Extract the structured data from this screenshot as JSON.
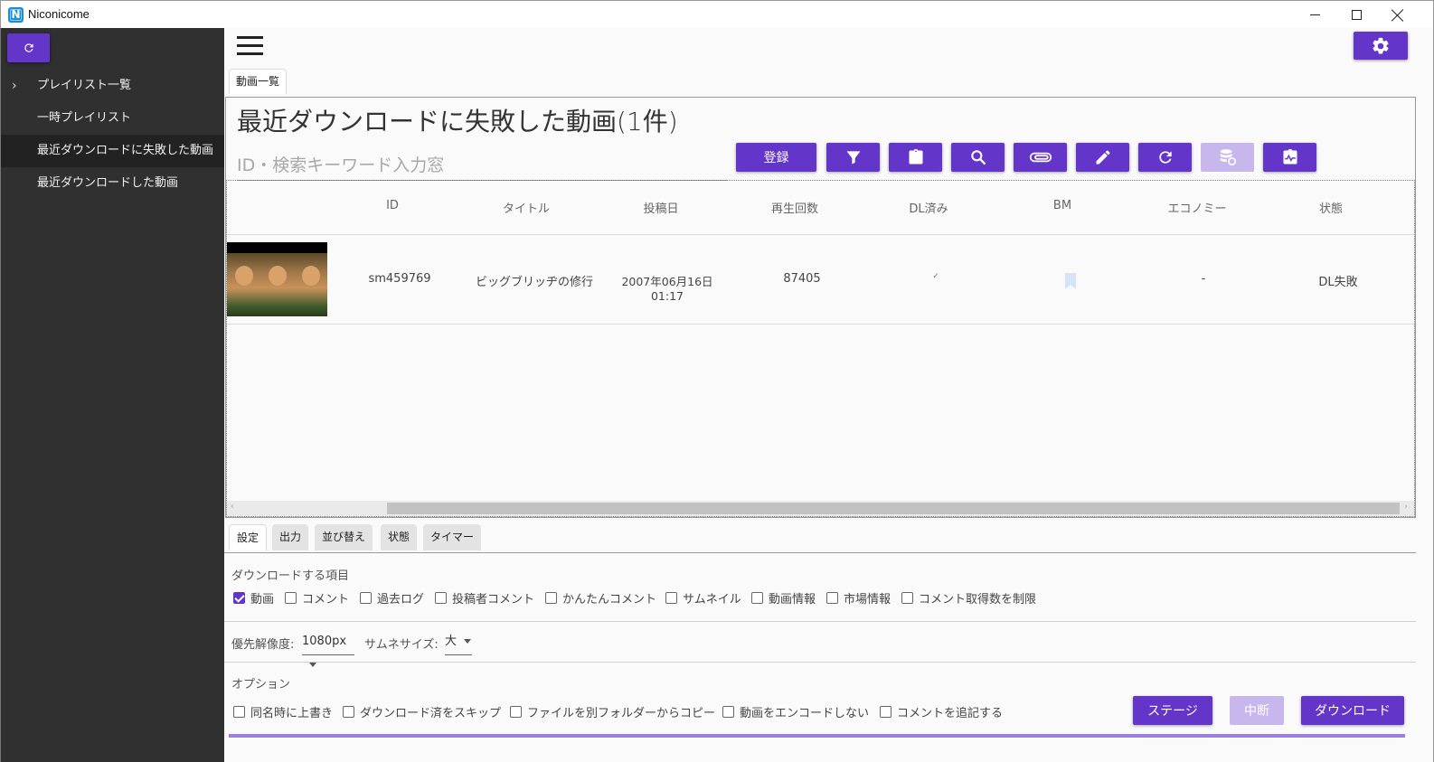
{
  "window": {
    "title": "Niconicome"
  },
  "sidebar": {
    "items": [
      {
        "label": "プレイリスト一覧",
        "expandable": true
      },
      {
        "label": "一時プレイリスト"
      },
      {
        "label": "最近ダウンロードに失敗した動画",
        "selected": true
      },
      {
        "label": "最近ダウンロードした動画"
      }
    ]
  },
  "main": {
    "top_tab": "動画一覧",
    "title": "最近ダウンロードに失敗した動画(1件)",
    "search_placeholder": "ID・検索キーワード入力窓",
    "register_label": "登録"
  },
  "table": {
    "columns": [
      "ID",
      "タイトル",
      "投稿日",
      "再生回数",
      "DL済み",
      "BM",
      "エコノミー",
      "状態"
    ],
    "rows": [
      {
        "id": "sm459769",
        "title": "ビッグブリッヂの修行",
        "date": "2007年06月16日 01:17",
        "views": "87405",
        "dl": "✓",
        "economy": "-",
        "status": "DL失敗"
      }
    ]
  },
  "bottom_tabs": [
    "設定",
    "出力",
    "並び替え",
    "状態",
    "タイマー"
  ],
  "settings": {
    "download_items_label": "ダウンロードする項目",
    "download_items": [
      {
        "label": "動画",
        "checked": true
      },
      {
        "label": "コメント",
        "checked": false
      },
      {
        "label": "過去ログ",
        "checked": false
      },
      {
        "label": "投稿者コメント",
        "checked": false
      },
      {
        "label": "かんたんコメント",
        "checked": false
      },
      {
        "label": "サムネイル",
        "checked": false
      },
      {
        "label": "動画情報",
        "checked": false
      },
      {
        "label": "市場情報",
        "checked": false
      },
      {
        "label": "コメント取得数を制限",
        "checked": false
      }
    ],
    "resolution_label": "優先解像度:",
    "resolution_value": "1080px",
    "thumb_size_label": "サムネサイズ:",
    "thumb_size_value": "大",
    "options_label": "オプション",
    "options": [
      {
        "label": "同名時に上書き",
        "checked": false
      },
      {
        "label": "ダウンロード済をスキップ",
        "checked": false
      },
      {
        "label": "ファイルを別フォルダーからコピー",
        "checked": false
      },
      {
        "label": "動画をエンコードしない",
        "checked": false
      },
      {
        "label": "コメントを追記する",
        "checked": false
      }
    ]
  },
  "actions": {
    "stage": "ステージ",
    "cancel": "中断",
    "download": "ダウンロード"
  },
  "colors": {
    "accent": "#6435c9",
    "accent_disabled": "#c8b7ec",
    "sidebar_bg": "#303030"
  }
}
